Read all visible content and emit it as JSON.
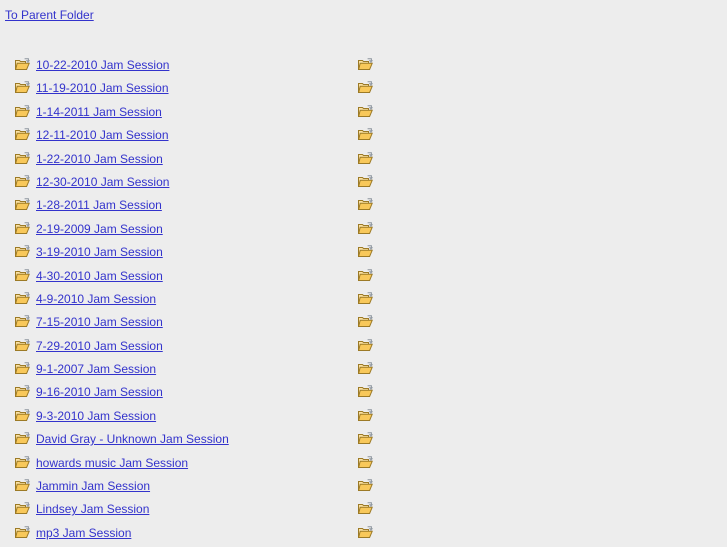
{
  "page": {
    "background_color": "#ededed",
    "link_color": "#3333cc",
    "parent_link": {
      "label": "To Parent Folder",
      "icon": "none"
    }
  },
  "icons": {
    "folder_shortcut": {
      "name": "open-folder-shortcut-icon",
      "body_color": "#f5c451",
      "body_light": "#fde9b6",
      "outline_color": "#a07d28",
      "badge_color": "#9aa3ad"
    }
  },
  "file_list": {
    "column_count": 2,
    "rows": [
      {
        "label": "10-22-2010 Jam Session",
        "left_icon": "open-folder-shortcut-icon",
        "right_icon": "open-folder-shortcut-icon"
      },
      {
        "label": "11-19-2010 Jam Session",
        "left_icon": "open-folder-shortcut-icon",
        "right_icon": "open-folder-shortcut-icon"
      },
      {
        "label": "1-14-2011 Jam Session",
        "left_icon": "open-folder-shortcut-icon",
        "right_icon": "open-folder-shortcut-icon"
      },
      {
        "label": "12-11-2010 Jam Session",
        "left_icon": "open-folder-shortcut-icon",
        "right_icon": "open-folder-shortcut-icon"
      },
      {
        "label": "1-22-2010 Jam Session",
        "left_icon": "open-folder-shortcut-icon",
        "right_icon": "open-folder-shortcut-icon"
      },
      {
        "label": "12-30-2010 Jam Session",
        "left_icon": "open-folder-shortcut-icon",
        "right_icon": "open-folder-shortcut-icon"
      },
      {
        "label": "1-28-2011 Jam Session",
        "left_icon": "open-folder-shortcut-icon",
        "right_icon": "open-folder-shortcut-icon"
      },
      {
        "label": "2-19-2009 Jam Session",
        "left_icon": "open-folder-shortcut-icon",
        "right_icon": "open-folder-shortcut-icon"
      },
      {
        "label": "3-19-2010 Jam Session",
        "left_icon": "open-folder-shortcut-icon",
        "right_icon": "open-folder-shortcut-icon"
      },
      {
        "label": "4-30-2010 Jam Session",
        "left_icon": "open-folder-shortcut-icon",
        "right_icon": "open-folder-shortcut-icon"
      },
      {
        "label": "4-9-2010 Jam Session",
        "left_icon": "open-folder-shortcut-icon",
        "right_icon": "open-folder-shortcut-icon"
      },
      {
        "label": "7-15-2010 Jam Session",
        "left_icon": "open-folder-shortcut-icon",
        "right_icon": "open-folder-shortcut-icon"
      },
      {
        "label": "7-29-2010 Jam Session",
        "left_icon": "open-folder-shortcut-icon",
        "right_icon": "open-folder-shortcut-icon"
      },
      {
        "label": "9-1-2007 Jam Session",
        "left_icon": "open-folder-shortcut-icon",
        "right_icon": "open-folder-shortcut-icon"
      },
      {
        "label": "9-16-2010 Jam Session",
        "left_icon": "open-folder-shortcut-icon",
        "right_icon": "open-folder-shortcut-icon"
      },
      {
        "label": "9-3-2010 Jam Session",
        "left_icon": "open-folder-shortcut-icon",
        "right_icon": "open-folder-shortcut-icon"
      },
      {
        "label": "David Gray - Unknown Jam Session",
        "left_icon": "open-folder-shortcut-icon",
        "right_icon": "open-folder-shortcut-icon"
      },
      {
        "label": "howards music Jam Session",
        "left_icon": "open-folder-shortcut-icon",
        "right_icon": "open-folder-shortcut-icon"
      },
      {
        "label": "Jammin Jam Session",
        "left_icon": "open-folder-shortcut-icon",
        "right_icon": "open-folder-shortcut-icon"
      },
      {
        "label": "Lindsey Jam Session",
        "left_icon": "open-folder-shortcut-icon",
        "right_icon": "open-folder-shortcut-icon"
      },
      {
        "label": "mp3 Jam Session",
        "left_icon": "open-folder-shortcut-icon",
        "right_icon": "open-folder-shortcut-icon"
      }
    ]
  }
}
